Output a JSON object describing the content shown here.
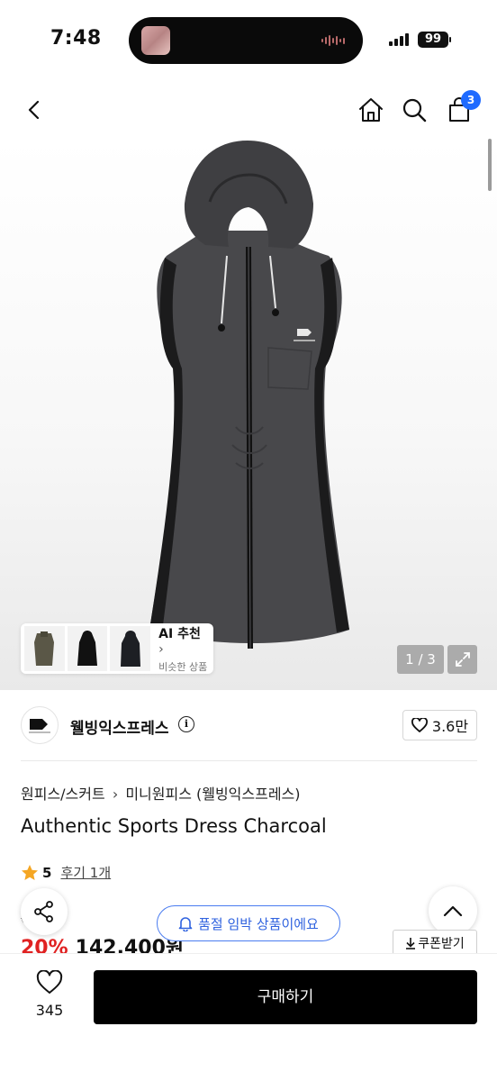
{
  "status_bar": {
    "time": "7:48",
    "battery": "99"
  },
  "header": {
    "cart_count": "3"
  },
  "gallery": {
    "ai_title": "AI 추천",
    "ai_subtitle": "비슷한 상품",
    "counter": "1 / 3"
  },
  "brand": {
    "name": "웰빙익스프레스",
    "likes": "3.6만"
  },
  "product": {
    "breadcrumb": [
      "원피스/스커트",
      "미니원피스 (웰빙익스프레스)"
    ],
    "title": "Authentic Sports Dress Charcoal",
    "rating": "5",
    "reviews": "후기 1개",
    "original_price": "0원",
    "discount": "20%",
    "price": "142,400원"
  },
  "floating": {
    "alert": "품절 임박 상품이에요",
    "coupon": "쿠폰받기"
  },
  "bottom": {
    "wish_count": "345",
    "buy_label": "구매하기"
  },
  "colors": {
    "accent_blue": "#1f6bff",
    "discount_red": "#e02222",
    "star": "#f5a623"
  }
}
